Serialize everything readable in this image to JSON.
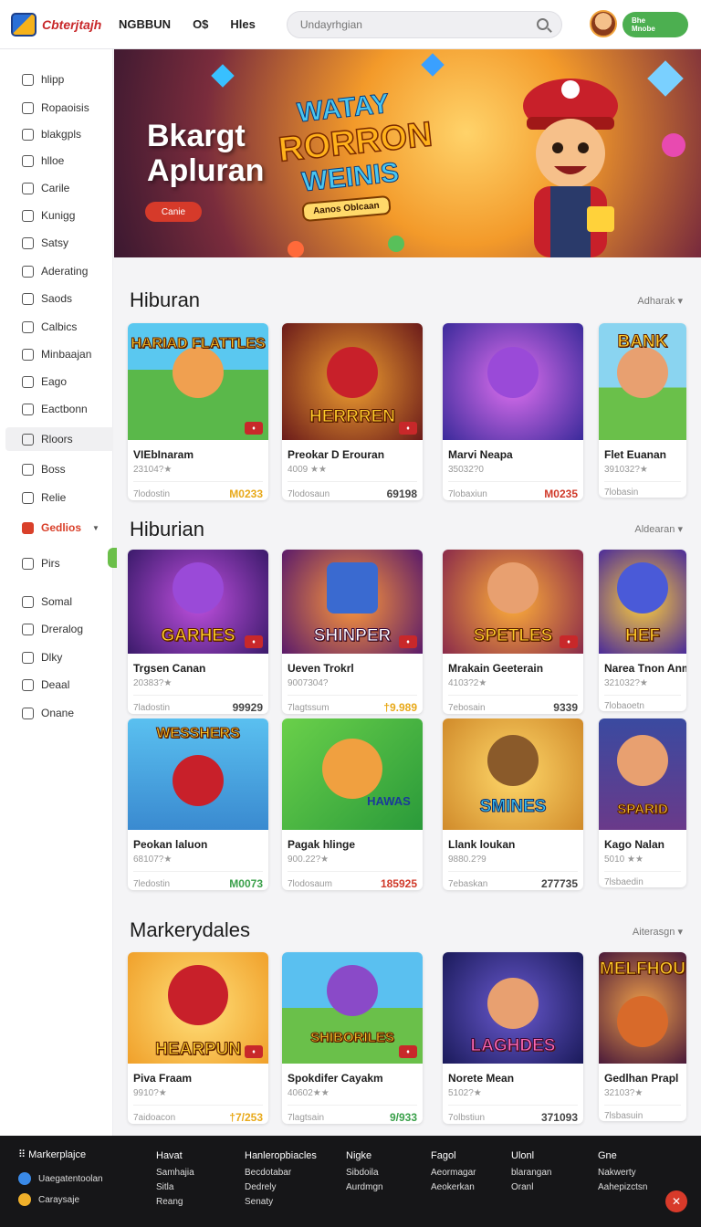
{
  "header": {
    "logo_text": "Cbterjtajh",
    "nav": [
      "NGBBUN",
      "O$",
      "Hles"
    ],
    "search_placeholder": "Undayrhgian",
    "user_badge_line1": "Bhe",
    "user_badge_line2": "Mnobe"
  },
  "sidebar": {
    "items": [
      {
        "label": "hlipp",
        "state": "active"
      },
      {
        "label": "Ropaoisis"
      },
      {
        "label": "blakgpls"
      },
      {
        "label": "hlloe"
      },
      {
        "label": "Carile"
      },
      {
        "label": "Kunigg"
      },
      {
        "label": "Satsy"
      },
      {
        "label": "Aderating"
      },
      {
        "label": "Saods"
      },
      {
        "label": "Calbics"
      },
      {
        "label": "Minbaajan"
      },
      {
        "label": "Eago"
      },
      {
        "label": "Eactbonn"
      },
      {
        "label": "Rloors",
        "state": "boxed"
      },
      {
        "label": "Boss"
      },
      {
        "label": "Relie"
      },
      {
        "label": "Gedlios",
        "state": "red"
      },
      {
        "label": "Pirs"
      },
      {
        "label": "Somal"
      },
      {
        "label": "Dreralog"
      },
      {
        "label": "Dlky"
      },
      {
        "label": "Deaal"
      },
      {
        "label": "Onane"
      }
    ],
    "accent": "#d9402a"
  },
  "hero": {
    "title_line1": "Bkargt",
    "title_line2": "Apluran",
    "button": "Canie",
    "logo_line1": "WATAY",
    "logo_line2": "RORRON",
    "logo_line3": "WEINIS",
    "tagline": "Aanos Oblcaan"
  },
  "sections": [
    {
      "title": "Hiburan",
      "more": "Adharak",
      "cards": [
        {
          "art": "HARIAD FLATTLES",
          "name": "VIEbInaram",
          "meta": "23104?★",
          "footer": "7lodostin",
          "price": "M0233",
          "price_color": "#e8a91a"
        },
        {
          "art": "HERRREN",
          "name": "Preokar D Erouran",
          "meta": "4009 ★★",
          "footer": "7lodosaun",
          "price": "69198",
          "price_color": "#444"
        },
        {
          "art": "",
          "name": "Marvi Neapa",
          "meta": "35032?0",
          "footer": "7lobaxiun",
          "price": "M0235",
          "price_color": "#d03a2a"
        },
        {
          "art": "BANK",
          "name": "Flet Euanan",
          "meta": "391032?★",
          "footer": "7lobasin",
          "price": "",
          "price_color": "#444"
        }
      ]
    },
    {
      "title": "Hiburian",
      "more": "Aldearan",
      "cards": [
        {
          "art": "GARHES",
          "name": "Trgsen Canan",
          "meta": "20383?★",
          "footer": "7ladostin",
          "price": "99929",
          "price_color": "#444"
        },
        {
          "art": "SHINPER",
          "name": "Ueven Trokrl",
          "meta": "9007304?",
          "footer": "7lagtssum",
          "price": "†9.989",
          "price_color": "#e8a91a"
        },
        {
          "art": "SPETLES",
          "name": "Mrakain Geeterain",
          "meta": "4103?2★",
          "footer": "7ebosain",
          "price": "9339",
          "price_color": "#444"
        },
        {
          "art": "HEF",
          "name": "Narea Tnon Anm",
          "meta": "321032?★",
          "footer": "7lobaoetn",
          "price": "",
          "price_color": "#444"
        }
      ]
    },
    {
      "title": "",
      "more": "",
      "cards": [
        {
          "art": "WESSHERS",
          "name": "Peokan laluon",
          "meta": "68107?★",
          "footer": "7ledostin",
          "price": "M0073",
          "price_color": "#3aa04a"
        },
        {
          "art": "HAWAS",
          "name": "Pagak hlinge",
          "meta": "900.22?★",
          "footer": "7lodosaum",
          "price": "185925",
          "price_color": "#d03a2a"
        },
        {
          "art": "SMINES",
          "name": "Llank loukan",
          "meta": "9880.2?9",
          "footer": "7ebaskan",
          "price": "277735",
          "price_color": "#444"
        },
        {
          "art": "SPARID",
          "name": "Kago Nalan",
          "meta": "5010 ★★",
          "footer": "7lsbaedin",
          "price": "",
          "price_color": "#444"
        }
      ]
    },
    {
      "title": "Markerydales",
      "more": "Aiterasgn",
      "cards": [
        {
          "art": "HEARPUN",
          "name": "Piva Fraam",
          "meta": "9910?★",
          "footer": "7aidoacon",
          "price": "†7/253",
          "price_color": "#e8a91a"
        },
        {
          "art": "SHIBORILES",
          "name": "Spokdifer Cayakm",
          "meta": "40602★★",
          "footer": "7lagtsain",
          "price": "9/933",
          "price_color": "#3aa04a"
        },
        {
          "art": "LAGHDES",
          "name": "Norete Mean",
          "meta": "5102?★",
          "footer": "7olbstiun",
          "price": "371093",
          "price_color": "#444"
        },
        {
          "art": "MELFHOU",
          "name": "Gedlhan Prapl",
          "meta": "32103?★",
          "footer": "7lsbasuin",
          "price": "",
          "price_color": "#444"
        }
      ]
    }
  ],
  "footer": {
    "brand": "Markerplajce",
    "brand_rows": [
      "Uaegatentoolan",
      "Caraysaje"
    ],
    "cols": [
      {
        "head": "Havat",
        "items": [
          "Samhajia",
          "Sitla",
          "Reang"
        ]
      },
      {
        "head": "Hanleropbiacles",
        "items": [
          "Becdotabar",
          "Dedrely",
          "Senaty"
        ]
      },
      {
        "head": "Nigke",
        "items": [
          "Sibdoila",
          "Aurdmgn"
        ]
      },
      {
        "head": "Fagol",
        "items": [
          "Aeormagar",
          "Aeokerkan"
        ]
      },
      {
        "head": "Ulonl",
        "items": [
          "blarangan",
          "Oranl"
        ]
      },
      {
        "head": "Gne",
        "items": [
          "Nakwerty",
          "Aahepizctsn"
        ]
      }
    ],
    "fab": "✕"
  }
}
